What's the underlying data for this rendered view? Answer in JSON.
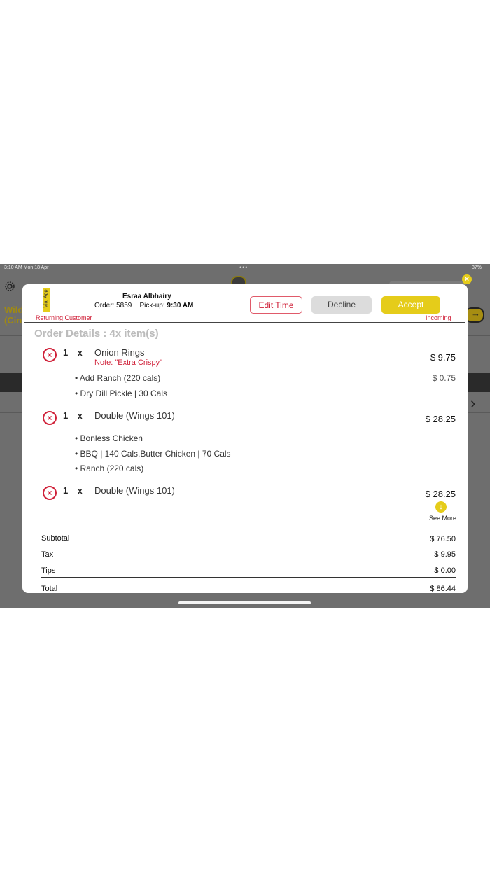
{
  "status_bar": {
    "time": "3:10 AM  Mon 18 Apr",
    "dots": "•••",
    "right": "37%"
  },
  "background": {
    "title_line1": "Wild",
    "title_line2": "(Cin"
  },
  "modal": {
    "close_icon": "×",
    "via_tag": "Via: App",
    "customer_name": "Esraa Albhairy",
    "order_label": "Order:",
    "order_number": "5859",
    "pickup_label": "Pick-up:",
    "pickup_time": "9:30 AM",
    "edit_time": "Edit Time",
    "decline": "Decline",
    "accept": "Accept",
    "returning_customer": "Returning Customer",
    "incoming": "Incoming",
    "details_title": "Order Details : 4x item(s)",
    "items": [
      {
        "qty": "1",
        "x": "x",
        "name": "Onion Rings",
        "note": "Note: \"Extra Crispy\"",
        "price": "$ 9.75",
        "modifiers": [
          {
            "text": "Add Ranch (220 cals)",
            "price": "$ 0.75"
          },
          {
            "text": "Dry Dill Pickle | 30 Cals",
            "price": ""
          }
        ]
      },
      {
        "qty": "1",
        "x": "x",
        "name": "Double (Wings 101)",
        "note": "",
        "price": "$ 28.25",
        "modifiers": [
          {
            "text": "Bonless Chicken",
            "price": ""
          },
          {
            "text": "BBQ | 140 Cals,Butter Chicken | 70 Cals",
            "price": ""
          },
          {
            "text": "Ranch (220 cals)",
            "price": ""
          }
        ]
      },
      {
        "qty": "1",
        "x": "x",
        "name": "Double (Wings 101)",
        "note": "",
        "price": "$ 28.25",
        "modifiers": []
      }
    ],
    "see_more": "See More",
    "see_more_icon": "↓",
    "remove_icon": "×",
    "bullet": "•",
    "summary": {
      "subtotal_label": "Subtotal",
      "subtotal": "$ 76.50",
      "tax_label": "Tax",
      "tax": "$ 9.95",
      "tips_label": "Tips",
      "tips": "$ 0.00",
      "total_label": "Total",
      "total": "$ 86.44"
    }
  },
  "colors": {
    "accent_yellow": "#e5cc1a",
    "alert_red": "#d0223a",
    "dim_overlay": "#6e6e6e"
  }
}
